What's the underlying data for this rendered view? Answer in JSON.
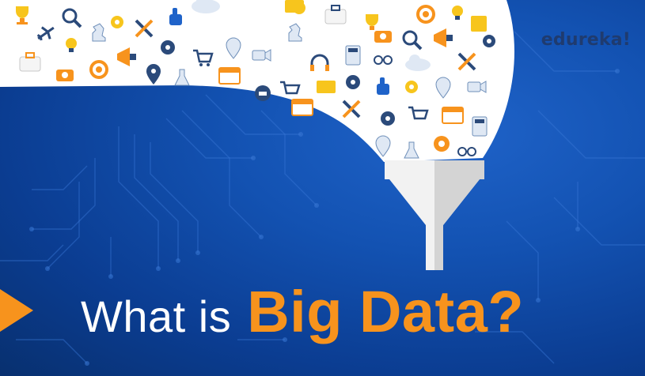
{
  "brand": {
    "logo_text": "edureka!"
  },
  "headline": {
    "lead": "What is",
    "highlight": "Big Data?"
  },
  "colors": {
    "background": "#1352b2",
    "accent": "#f7931d",
    "text": "#ffffff",
    "logo": "#1f3b6f",
    "cloud": "#ffffff"
  },
  "icons": [
    "trophy-icon",
    "magnifier-icon",
    "tools-icon",
    "thumbs-up-icon",
    "cloud-icon",
    "megaphone-icon",
    "briefcase-icon",
    "airplane-icon",
    "chess-knight-icon",
    "gear-icon",
    "lightbulb-icon",
    "shopping-cart-icon",
    "location-pin-icon",
    "calendar-icon",
    "target-icon",
    "camera-icon",
    "headphones-icon",
    "telephone-icon",
    "calculator-icon",
    "glasses-icon",
    "flask-icon",
    "video-camera-icon",
    "folder-icon"
  ]
}
